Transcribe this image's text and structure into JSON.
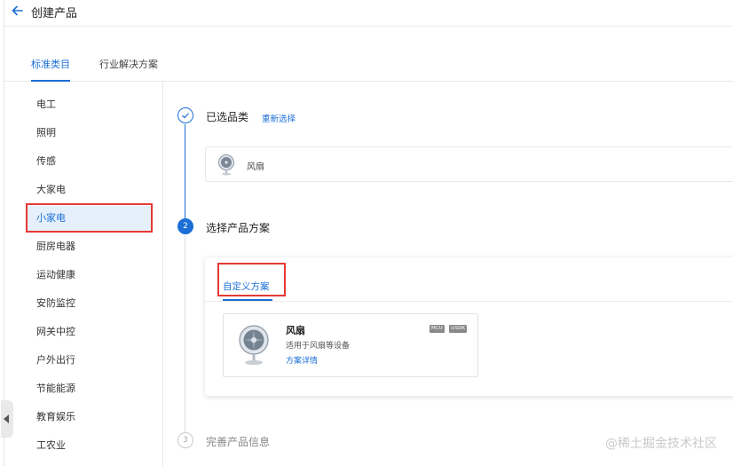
{
  "header": {
    "title": "创建产品"
  },
  "top_tabs": [
    {
      "label": "标准类目",
      "active": true
    },
    {
      "label": "行业解决方案",
      "active": false
    }
  ],
  "sidebar": {
    "items": [
      {
        "label": "电工"
      },
      {
        "label": "照明"
      },
      {
        "label": "传感"
      },
      {
        "label": "大家电"
      },
      {
        "label": "小家电",
        "active": true
      },
      {
        "label": "厨房电器"
      },
      {
        "label": "运动健康"
      },
      {
        "label": "安防监控"
      },
      {
        "label": "网关中控"
      },
      {
        "label": "户外出行"
      },
      {
        "label": "节能能源"
      },
      {
        "label": "教育娱乐"
      },
      {
        "label": "工农业"
      }
    ]
  },
  "steps": {
    "step1": {
      "title": "已选品类",
      "action": "重新选择",
      "selected": "风扇"
    },
    "step2": {
      "number": "2",
      "title": "选择产品方案"
    },
    "step3": {
      "number": "3",
      "title": "完善产品信息"
    }
  },
  "solution": {
    "tab": "自定义方案",
    "card": {
      "title": "风扇",
      "description": "适用于风扇等设备",
      "link": "方案详情",
      "badges": [
        "MCU",
        "SDK"
      ]
    }
  },
  "watermark": "@稀土掘金技术社区",
  "colors": {
    "accent": "#1b6fd6",
    "highlight_box": "#e53935",
    "active_bg": "#e6f0fc"
  }
}
